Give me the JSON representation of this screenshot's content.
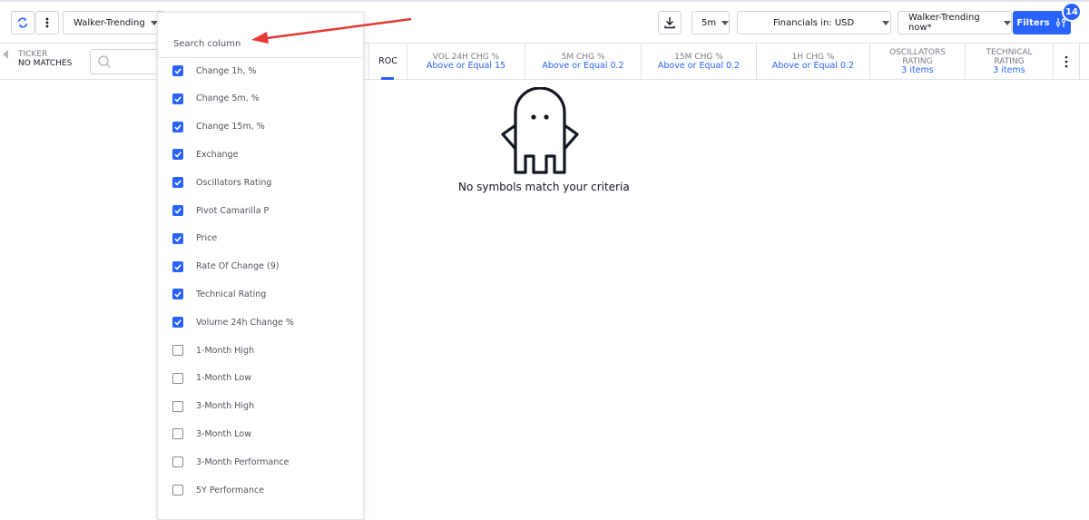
{
  "toolbar": {
    "screen_name": "Walker-Trending",
    "timeframe": "5m",
    "financials": "Financials in: USD",
    "saved_screen": "Walker-Trending now*",
    "filters_label": "Filters",
    "filters_count": "14"
  },
  "table": {
    "ticker_label": "TICKER",
    "ticker_sub": "NO MATCHES",
    "columns": [
      {
        "title": "ROC",
        "sub": ""
      },
      {
        "title": "VOL 24H CHG %",
        "sub": "Above or Equal 15"
      },
      {
        "title": "5M CHG %",
        "sub": "Above or Equal 0.2"
      },
      {
        "title": "15M CHG %",
        "sub": "Above or Equal 0.2"
      },
      {
        "title": "1H CHG %",
        "sub": "Above or Equal 0.2"
      },
      {
        "title": "OSCILLATORS RATING",
        "sub": "3 items"
      },
      {
        "title": "TECHNICAL RATING",
        "sub": "3 items"
      }
    ],
    "empty_message": "No symbols match your criteria"
  },
  "column_picker": {
    "search_placeholder": "Search column",
    "options": [
      {
        "label": "Change 1h, %",
        "checked": true
      },
      {
        "label": "Change 5m, %",
        "checked": true
      },
      {
        "label": "Change 15m, %",
        "checked": true
      },
      {
        "label": "Exchange",
        "checked": true
      },
      {
        "label": "Oscillators Rating",
        "checked": true
      },
      {
        "label": "Pivot Camarilla P",
        "checked": true
      },
      {
        "label": "Price",
        "checked": true
      },
      {
        "label": "Rate Of Change (9)",
        "checked": true
      },
      {
        "label": "Technical Rating",
        "checked": true
      },
      {
        "label": "Volume 24h Change %",
        "checked": true
      },
      {
        "label": "1-Month High",
        "checked": false
      },
      {
        "label": "1-Month Low",
        "checked": false
      },
      {
        "label": "3-Month High",
        "checked": false
      },
      {
        "label": "3-Month Low",
        "checked": false
      },
      {
        "label": "3-Month Performance",
        "checked": false
      },
      {
        "label": "5Y Performance",
        "checked": false
      }
    ]
  },
  "colors": {
    "accent": "#2962ff",
    "annotation_arrow": "#e53935"
  }
}
